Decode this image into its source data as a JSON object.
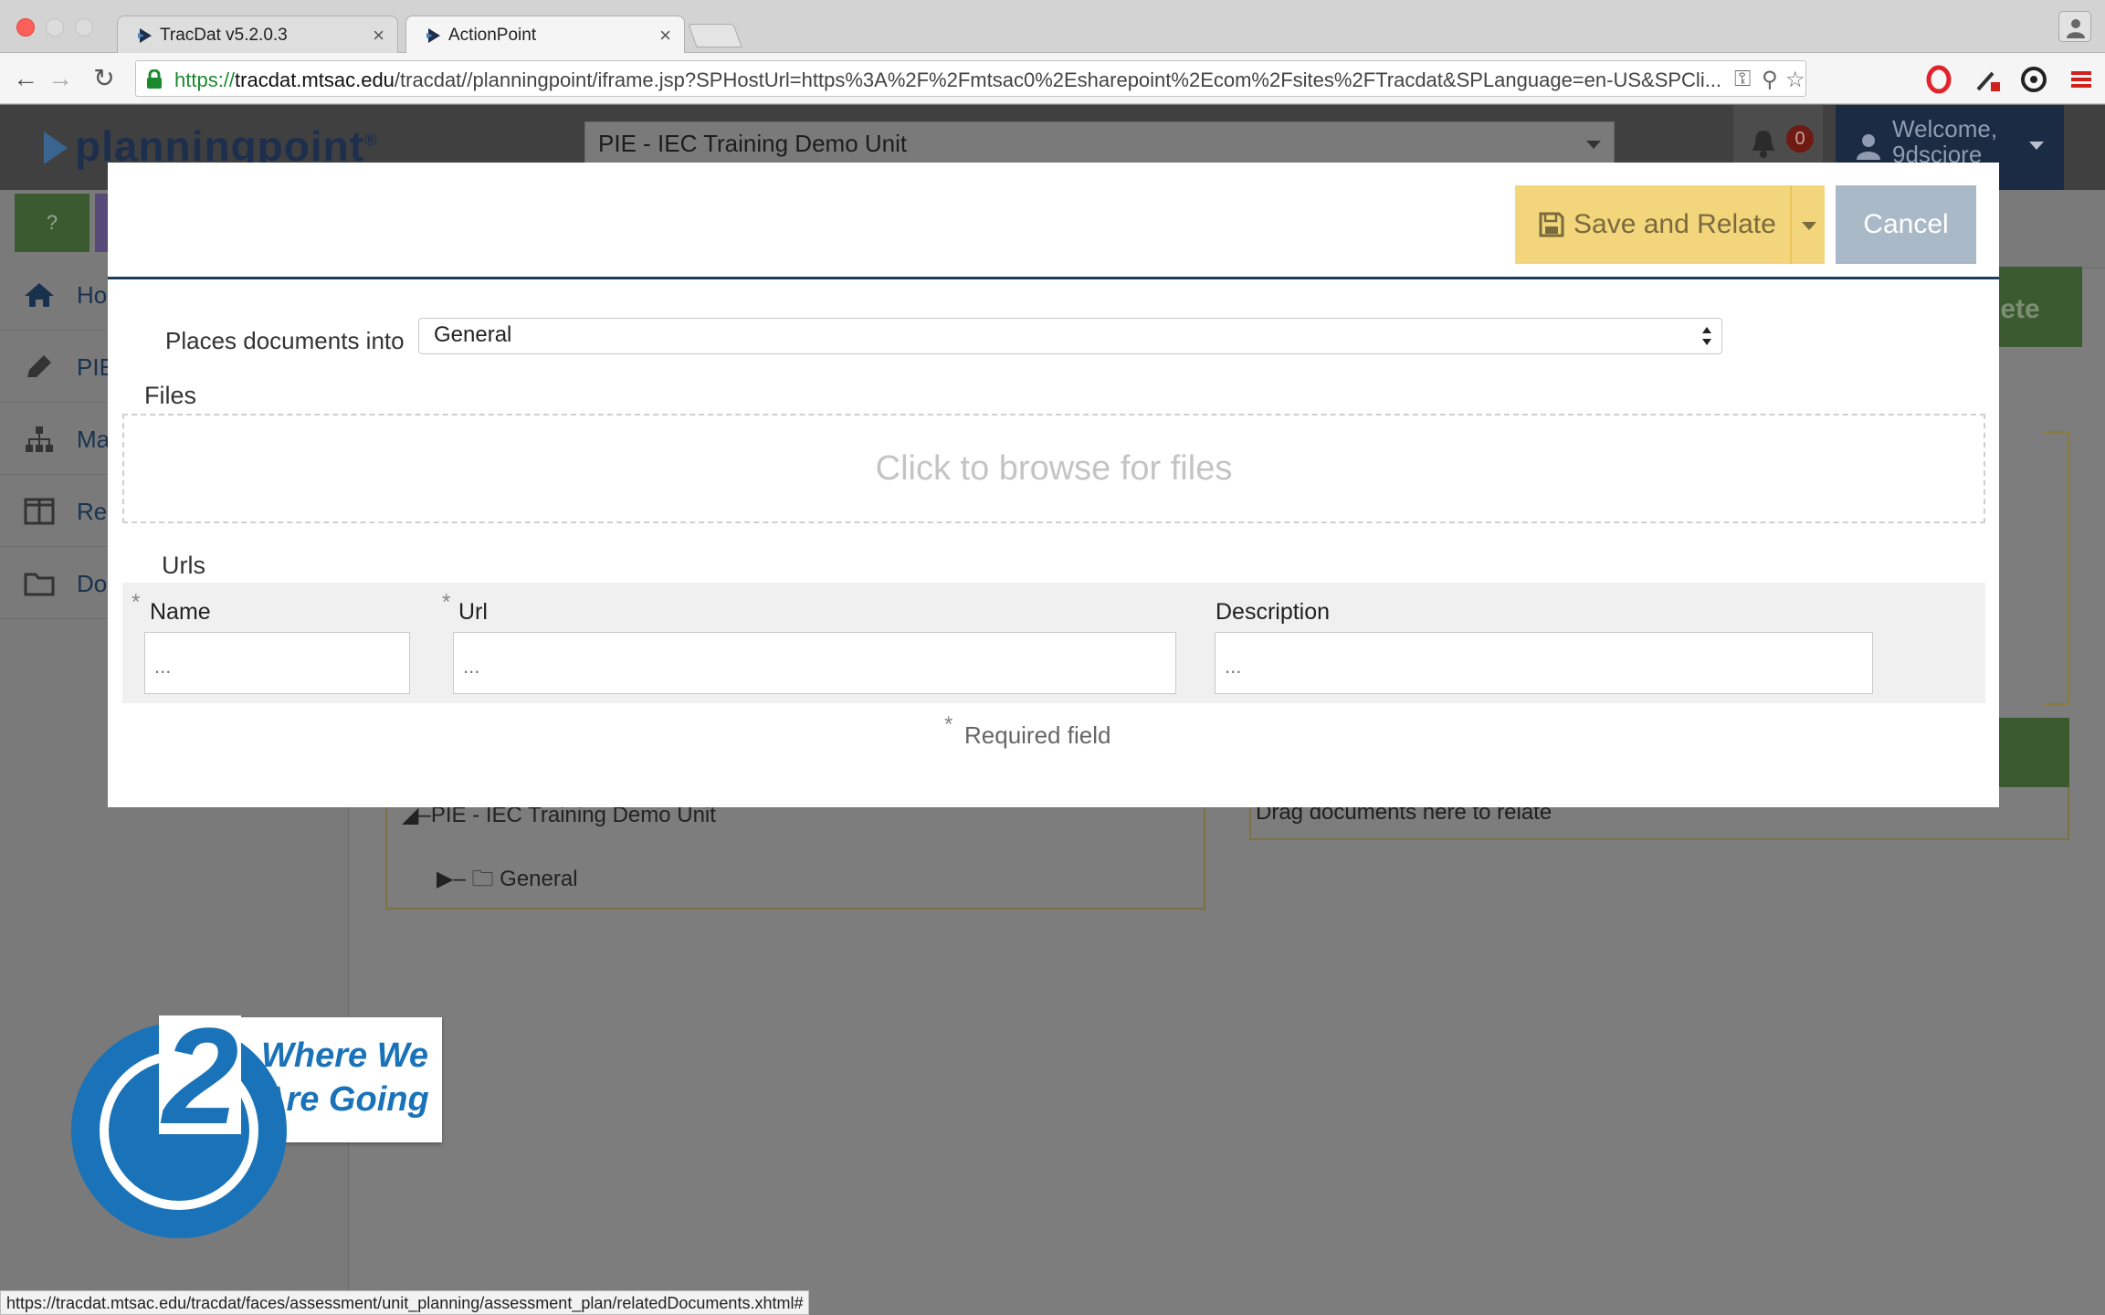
{
  "browser": {
    "tabs": [
      {
        "label": "TracDat v5.2.0.3",
        "active": false
      },
      {
        "label": "ActionPoint",
        "active": true
      }
    ],
    "url_scheme": "https",
    "url_host": "tracdat.mtsac.edu",
    "url_rest": "/tracdat//planningpoint/iframe.jsp?SPHostUrl=https%3A%2F%2Fmtsac0%2Esharepoint%2Ecom%2Fsites%2FTracdat&SPLanguage=en-US&SPCli...",
    "status_url": "https://tracdat.mtsac.edu/tracdat/faces/assessment/unit_planning/assessment_plan/relatedDocuments.xhtml#"
  },
  "app": {
    "logo": "planningpoint",
    "logo_mark": "®",
    "unit": "PIE - IEC Training Demo Unit",
    "notifications": "0",
    "welcome": "Welcome,",
    "user": "9dsciore",
    "help": "?",
    "sidebar": [
      {
        "label": "Ho",
        "icon": "home-icon"
      },
      {
        "label": "PIE",
        "icon": "pencil-icon"
      },
      {
        "label": "Ma",
        "icon": "org-chart-icon"
      },
      {
        "label": "Re",
        "icon": "columns-icon"
      },
      {
        "label": "Do",
        "icon": "folder-icon"
      }
    ],
    "complete_button": "lete",
    "tree_root": "PIE - IEC Training Demo Unit",
    "tree_child": "General",
    "drag_hint": "Drag documents here to relate"
  },
  "modal": {
    "save_label": "Save and Relate",
    "cancel_label": "Cancel",
    "places_label": "Places documents into",
    "places_value": "General",
    "files_label": "Files",
    "dropzone_text": "Click to browse for files",
    "urls_label": "Urls",
    "columns": {
      "name": "Name",
      "url": "Url",
      "description": "Description"
    },
    "placeholder": "...",
    "required_star": "*",
    "required_note": "Required field"
  },
  "brand": {
    "number": "2",
    "line1": "Where We",
    "line2": "Are Going"
  },
  "colors": {
    "accent_yellow": "#f3d67c",
    "cancel_gray": "#a9b9c7",
    "header_navy": "#1d3d5c",
    "brand_blue": "#1a73b8"
  }
}
